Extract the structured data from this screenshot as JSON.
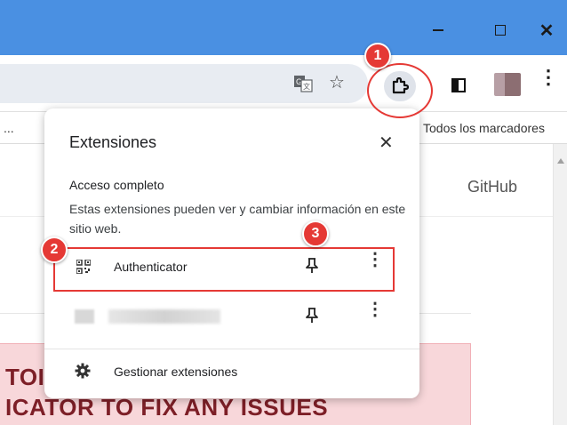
{
  "window": {
    "accent_color": "#4a90e2",
    "minimize_icon": "minimize-icon",
    "maximize_icon": "maximize-icon",
    "close_glyph": "✕"
  },
  "toolbar": {
    "star_glyph": "☆",
    "menu_glyph": "⋮"
  },
  "bookmarks": {
    "ellipsis": "...",
    "all_bookmarks": "Todos los marcadores"
  },
  "content": {
    "github": "GitHub",
    "alert_line1": "TOI",
    "alert_line2": "ICATOR TO FIX ANY ISSUES",
    "alert_color": "#f8d7da"
  },
  "popup": {
    "title": "Extensiones",
    "close_glyph": "✕",
    "section_label": "Acceso completo",
    "section_desc": "Estas extensiones pueden ver y cambiar información en este sitio web.",
    "extensions": [
      {
        "name": "Authenticator",
        "menu_glyph": "⋮"
      },
      {
        "name": "",
        "menu_glyph": "⋮"
      }
    ],
    "manage_label": "Gestionar extensiones"
  },
  "annotations": {
    "badge1": "1",
    "badge2": "2",
    "badge3": "3",
    "highlight_color": "#e53935"
  }
}
